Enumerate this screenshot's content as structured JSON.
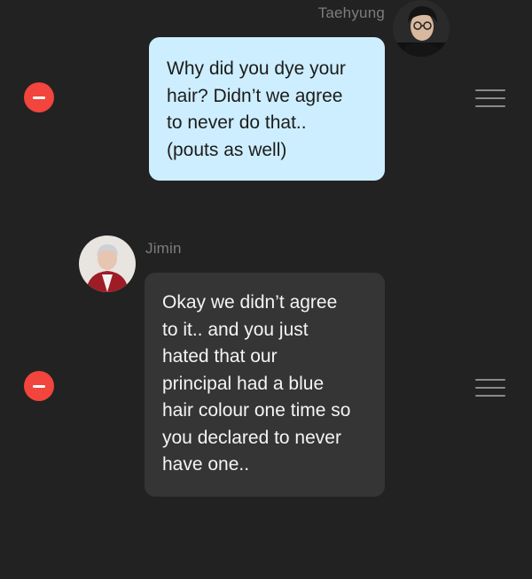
{
  "colors": {
    "background": "#222222",
    "outgoing_bubble": "#cdeefe",
    "incoming_bubble": "#353535",
    "remove_button": "#f1453d",
    "sender_name": "#7c7c7c"
  },
  "messages": [
    {
      "sender": "Taehyung",
      "direction": "outgoing",
      "avatar_icon": "person-avatar-icon",
      "text": "Why did you dye your\nhair? Didn’t we agree\nto never do that..\n(pouts as well)"
    },
    {
      "sender": "Jimin",
      "direction": "incoming",
      "avatar_icon": "person-avatar-icon",
      "text": "Okay we didn’t agree\nto it.. and you just\nhated that our\nprincipal had a blue\nhair colour one time so\nyou declared to never\nhave one.."
    }
  ],
  "controls": {
    "remove_icon": "minus-circle-icon",
    "reorder_icon": "drag-handle-icon"
  }
}
